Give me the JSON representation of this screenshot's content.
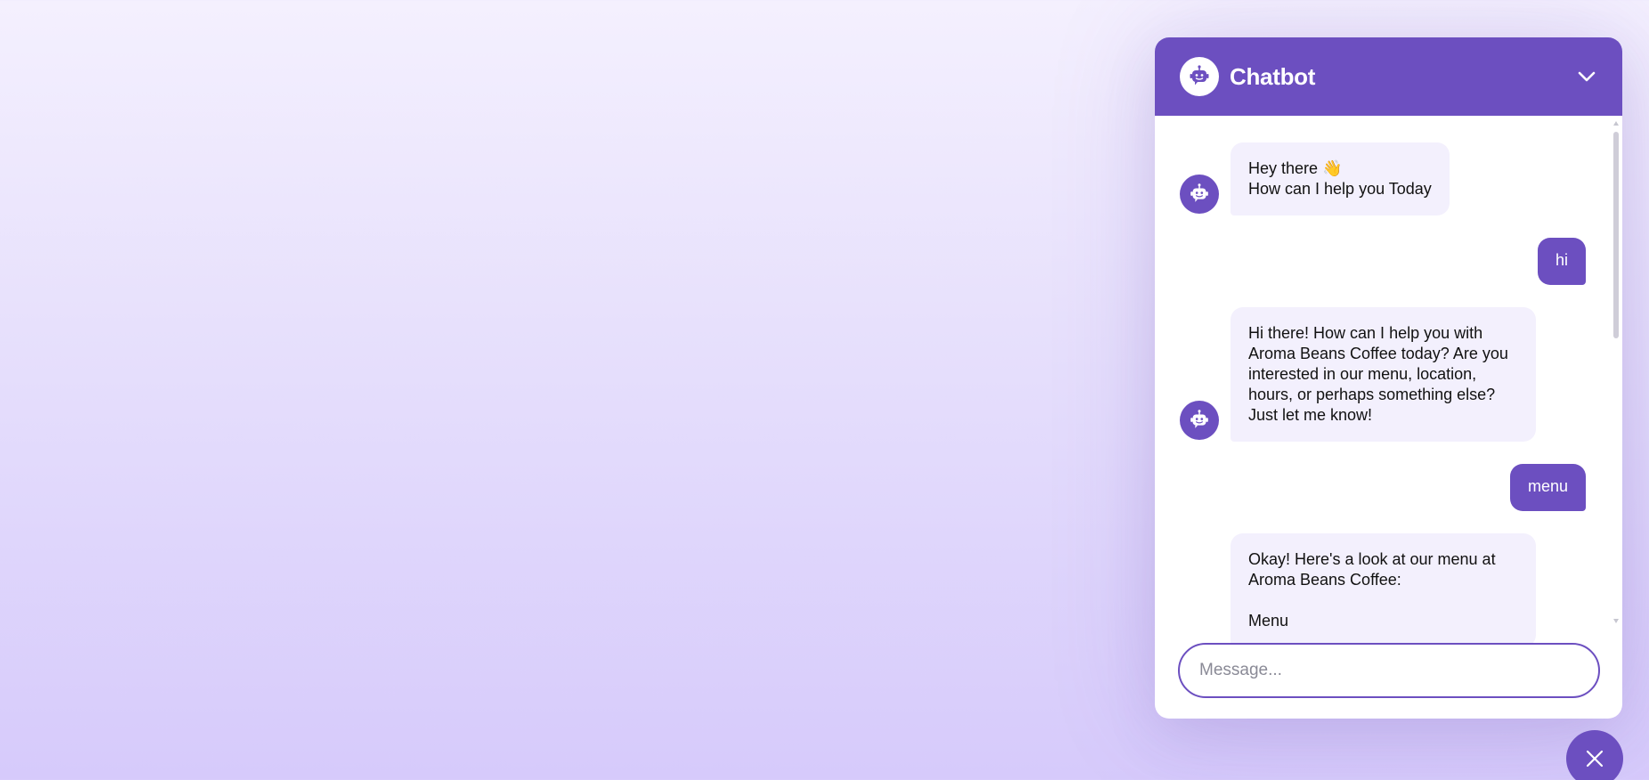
{
  "header": {
    "title": "Chatbot",
    "logo_icon": "robot-icon",
    "collapse_icon": "chevron-down-icon"
  },
  "messages": [
    {
      "role": "bot",
      "text": "Hey there 👋\nHow can I help you Today"
    },
    {
      "role": "user",
      "text": "hi"
    },
    {
      "role": "bot",
      "text": "Hi there! How can I help you with Aroma Beans Coffee today? Are you interested in our menu, location, hours, or perhaps something else? Just let me know!"
    },
    {
      "role": "user",
      "text": "menu"
    },
    {
      "role": "bot",
      "text": "Okay! Here's a look at our menu at Aroma Beans Coffee:\n\nMenu"
    }
  ],
  "input": {
    "placeholder": "Message...",
    "value": ""
  },
  "fab": {
    "icon": "close-icon"
  },
  "colors": {
    "accent": "#6c4fc0",
    "bot_bubble": "#f3f0fd",
    "background_top": "#f4f0fe",
    "background_bottom": "#d6cafb"
  }
}
